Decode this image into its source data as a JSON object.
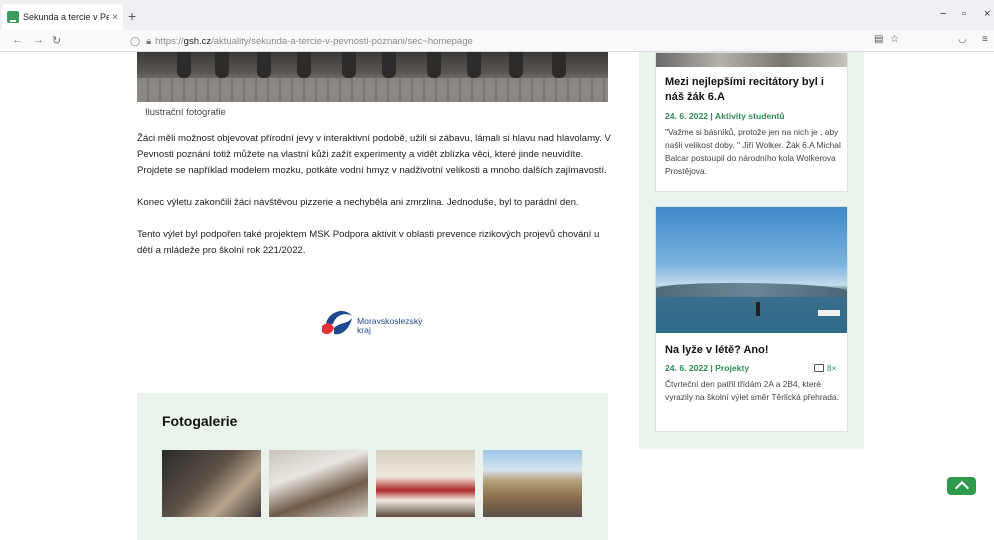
{
  "browser": {
    "tab_title": "Sekunda a tercie v Pevn",
    "tab_close": "×",
    "new_tab": "+",
    "url_proto": "https://",
    "url_domain": "gsh.cz",
    "url_path": "/aktuality/sekunda-a-tercie-v-pevnosti-poznani/sec~homepage",
    "window_controls": [
      "−",
      "▫",
      "×"
    ]
  },
  "article": {
    "photo_caption": "Ilustrační fotografie",
    "paragraphs": [
      "Žáci měli možnost objevovat přírodní jevy v interaktivní podobě, užili si zábavu, lámali si hlavu nad hlavolamy. V Pevnosti poznání totiž můžete na vlastní kůži zažít experimenty a vidět zblízka věci, které jinde neuvidíte. Projdete se například modelem mozku, potkáte vodní hmyz v nadživotní velikosti a mnoho dalších zajímavostí.",
      "Konec výletu zakončili žáci návštěvou pizzerie a nechyběla ani zmrzlina.  Jednoduše, byl to parádní den.",
      "Tento výlet byl podpořen také projektem MSK Podpora aktivit v oblasti prevence rizikových projevů chování u dětí a mládeže pro školní rok 221/2022."
    ],
    "logo_line1": "Moravskoslezský",
    "logo_line2": "kraj"
  },
  "gallery": {
    "title": "Fotogalerie"
  },
  "sidebar": {
    "cards": [
      {
        "title": "Mezi nejlepšími recitátory byl i náš žák 6.A",
        "meta": "24. 6. 2022 | Aktivity studentů",
        "text": "\"Važme si básníků, protože jen na nich je , aby našli velikost doby. \" Jiří Wolker. Žák 6.A Michal Balcar postoupil do národního kola Wolkerova Prostějova."
      },
      {
        "title": "Na lyže v létě? Ano!",
        "meta": "24. 6. 2022 | Projekty",
        "photo_count": "8×",
        "text": "Čtvrteční den patřil třídám 2A a 2B4, které vyrazily na školní výlet směr Těrlická přehrada."
      }
    ]
  },
  "icons": {
    "back": "←",
    "forward": "→",
    "reload": "↻",
    "reader": "▤",
    "bookmark": "☆",
    "pocket": "◡",
    "menu": "≡"
  }
}
